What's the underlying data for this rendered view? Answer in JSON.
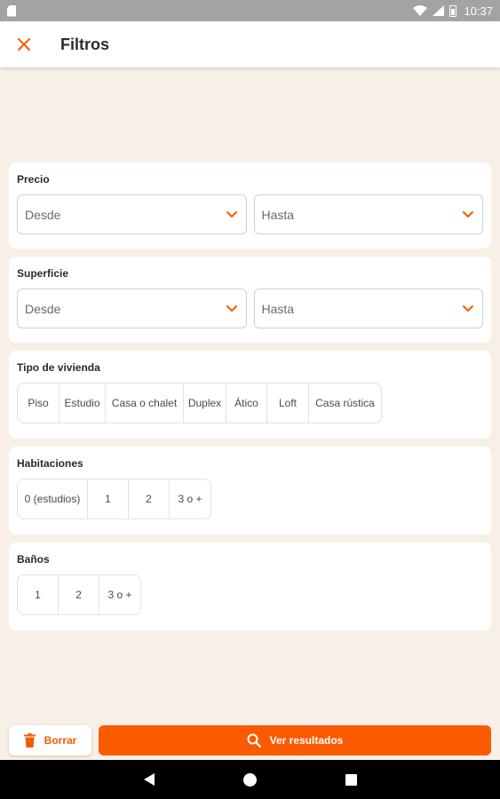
{
  "status_bar": {
    "time": "10:37"
  },
  "header": {
    "title": "Filtros",
    "close_icon": "close-icon"
  },
  "precio": {
    "title": "Precio",
    "desde": "Desde",
    "hasta": "Hasta"
  },
  "superficie": {
    "title": "Superficie",
    "desde": "Desde",
    "hasta": "Hasta"
  },
  "tipo_vivienda": {
    "title": "Tipo de vivienda",
    "options": [
      "Piso",
      "Estudio",
      "Casa o chalet",
      "Duplex",
      "Ático",
      "Loft",
      "Casa rústica"
    ]
  },
  "habitaciones": {
    "title": "Habitaciones",
    "options": [
      "0 (estudios)",
      "1",
      "2",
      "3 o +"
    ]
  },
  "banos": {
    "title": "Baños",
    "options": [
      "1",
      "2",
      "3 o +"
    ]
  },
  "actions": {
    "borrar": "Borrar",
    "ver_resultados": "Ver resultados"
  },
  "colors": {
    "accent": "#fb5a00",
    "background": "#f8f0e7",
    "status_bar": "#a3a3a3"
  }
}
